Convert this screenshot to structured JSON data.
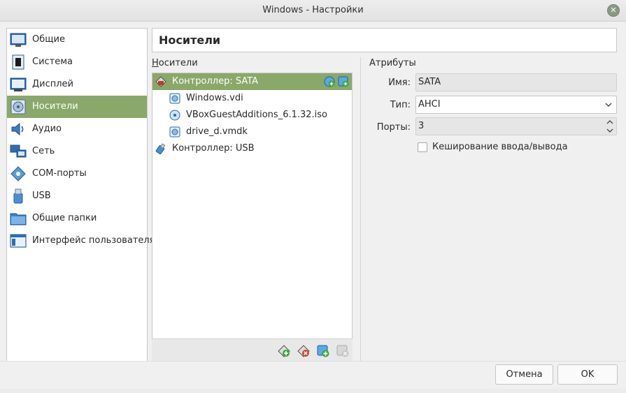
{
  "window": {
    "title": "Windows - Настройки"
  },
  "sidebar": {
    "items": [
      {
        "label": "Общие",
        "icon": "general-icon"
      },
      {
        "label": "Система",
        "icon": "system-icon"
      },
      {
        "label": "Дисплей",
        "icon": "display-icon"
      },
      {
        "label": "Носители",
        "icon": "storage-icon",
        "active": true
      },
      {
        "label": "Аудио",
        "icon": "audio-icon"
      },
      {
        "label": "Сеть",
        "icon": "network-icon"
      },
      {
        "label": "COM-порты",
        "icon": "serial-ports-icon"
      },
      {
        "label": "USB",
        "icon": "usb-icon"
      },
      {
        "label": "Общие папки",
        "icon": "shared-folders-icon"
      },
      {
        "label": "Интерфейс пользователя",
        "icon": "user-interface-icon"
      }
    ]
  },
  "page": {
    "title": "Носители"
  },
  "storage": {
    "section_label": "Носители",
    "tree": [
      {
        "label": "Контроллер: SATA",
        "type": "controller",
        "active": true
      },
      {
        "label": "Windows.vdi",
        "type": "hard-disk"
      },
      {
        "label": "VBoxGuestAdditions_6.1.32.iso",
        "type": "optical-disk"
      },
      {
        "label": "drive_d.vmdk",
        "type": "hard-disk"
      },
      {
        "label": "Контроллер: USB",
        "type": "controller"
      }
    ]
  },
  "attributes": {
    "section_label": "Атрибуты",
    "name_label": "Имя:",
    "name_value": "SATA",
    "type_label": "Тип:",
    "type_value": "AHCI",
    "ports_label": "Порты:",
    "ports_value": "3",
    "io_cache_label": "Кеширование ввода/вывода",
    "io_cache_checked": false
  },
  "buttons": {
    "cancel": "Отмена",
    "ok": "OK"
  },
  "colors": {
    "accent": "#8aa86a"
  }
}
